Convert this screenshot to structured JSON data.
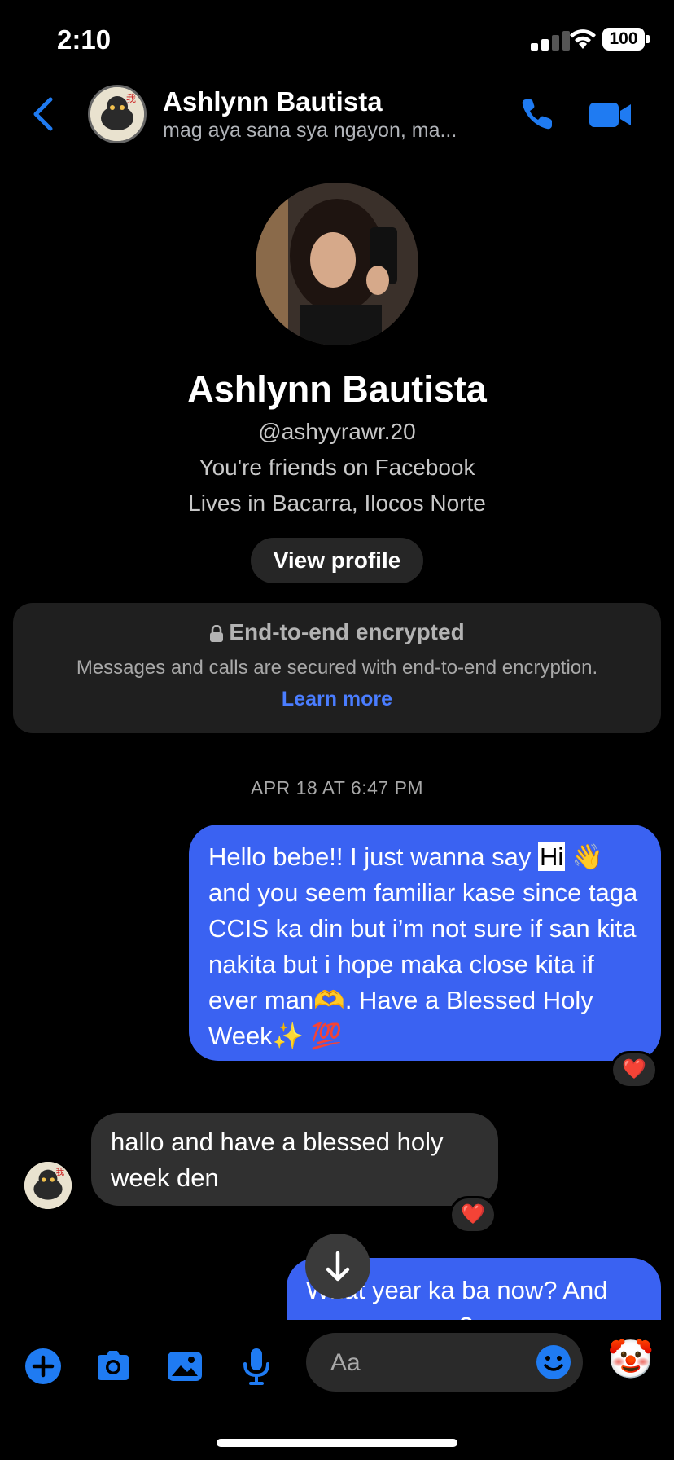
{
  "status_bar": {
    "time": "2:10",
    "battery": "100"
  },
  "header": {
    "name": "Ashlynn Bautista",
    "preview": "mag aya sana sya ngayon, ma..."
  },
  "profile": {
    "name": "Ashlynn Bautista",
    "username": "@ashyyrawr.20",
    "friends": "You're friends on Facebook",
    "location": "Lives in Bacarra, Ilocos Norte",
    "view_profile_label": "View profile"
  },
  "encryption": {
    "title": "End-to-end encrypted",
    "body": "Messages and calls are secured with end-to-end encryption.",
    "link": "Learn more"
  },
  "conversation": {
    "date": "APR 18 AT 6:47 PM",
    "messages": [
      {
        "from": "me",
        "text_before": "Hello bebe!! I just wanna say ",
        "highlight": "Hi",
        "text_after": " 👋 and you seem familiar kase since taga CCIS ka din but i’m not sure if san kita nakita but i hope maka close kita if ever man🫶. Have a Blessed Holy Week✨ 💯",
        "reaction": "❤️"
      },
      {
        "from": "them",
        "text": "hallo and have a blessed holy week den",
        "reaction": "❤️"
      },
      {
        "from": "me",
        "text": "What year ka ba now? And anong course?"
      }
    ]
  },
  "composer": {
    "placeholder": "Aa",
    "quick_reaction": "🤡"
  },
  "colors": {
    "accent": "#3a62f2",
    "icon_blue": "#1f7bf2",
    "bubble_in": "#303030",
    "link": "#4a7dff"
  },
  "icons": [
    "back-chevron-icon",
    "phone-icon",
    "video-camera-icon",
    "lock-icon",
    "scroll-down-arrow-icon",
    "plus-icon",
    "camera-icon",
    "gallery-icon",
    "microphone-icon",
    "emoji-icon"
  ]
}
